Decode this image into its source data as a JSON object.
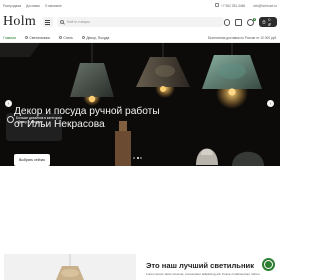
{
  "topbar": {
    "links": [
      "Распродажа",
      "Доставка",
      "О магазине"
    ],
    "phone": "+7 962 253-3466",
    "email": "info@holm-art.ru"
  },
  "header": {
    "logo": "Holm",
    "search_placeholder": "Найти товары",
    "favorites_count": "2",
    "cart_count": "0",
    "cart_label": "0 ₽"
  },
  "nav": {
    "items": [
      {
        "label": "Главная",
        "active": true
      },
      {
        "label": "Светильники",
        "active": false
      },
      {
        "label": "Стиль",
        "active": false
      },
      {
        "label": "Декор, Посуда",
        "active": false
      }
    ],
    "promo": "Бесплатная доставка по России от 10 000 руб."
  },
  "hero": {
    "promo_text": "Больше дизайнов в категории «Декор и посуда»",
    "title_line1": "Декор и посуда ручной работы",
    "title_line2": "от Ильи Некрасова",
    "button_label": "Выбрать сейчас",
    "prev_icon": "‹",
    "next_icon": "›",
    "slide_count": 3,
    "active_slide": 2
  },
  "section": {
    "title": "Это наш лучший светильник",
    "subtitle": "Lorem ipsum dolor sit amet, consectetur adipiscing elit. Fusce condimentum rutrum"
  },
  "colors": {
    "accent": "#2e7d32",
    "hero_bg": "#0c0b0a",
    "cart_bg": "#2e2e2e"
  },
  "icons": {
    "catalog": "menu-icon",
    "search": "search-icon",
    "account": "user-icon",
    "favorites": "heart-icon",
    "compare": "compare-icon",
    "cart": "bag-icon",
    "chat": "chat-icon"
  }
}
